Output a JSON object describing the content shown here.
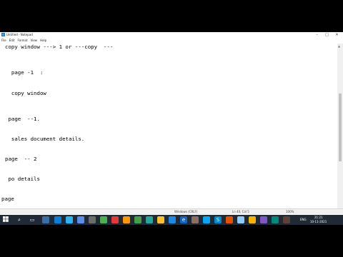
{
  "window": {
    "title": "Untitled - Notepad",
    "minimize_label": "–",
    "maximize_label": "□",
    "close_label": "✕"
  },
  "menu": [
    "File",
    "Edit",
    "Format",
    "View",
    "Help"
  ],
  "editor_lines": [
    "copy window ---> 1 or ---copy  ---",
    "  page -1  :",
    "  copy window",
    " page  --1.",
    "  sales document details.",
    "page  -- 2",
    " po details",
    "page"
  ],
  "status": {
    "line_ending": "Windows (CRLF)",
    "position": "Ln 40, Col 5",
    "zoom": "100%"
  },
  "tray": {
    "language": "ENG",
    "time": "21:21",
    "date": "10-11-2021"
  },
  "taskbar_icons": [
    "windows-start-icon",
    "search-icon",
    "task-view-icon",
    "file-explorer-icon",
    "edge-icon",
    "explorer-icon",
    "store-icon",
    "app-icon-1",
    "app-icon-2",
    "app-icon-3",
    "app-icon-4",
    "app-icon-5",
    "app-icon-6",
    "app-icon-7",
    "app-icon-8",
    "ie-icon",
    "app-icon-9",
    "app-icon-10",
    "skype-icon",
    "app-icon-11",
    "notepad-icon",
    "chrome-icon",
    "app-icon-12",
    "app-icon-13",
    "app-icon-14"
  ],
  "colors": {
    "taskbar": "#1f2a36",
    "accent": "#0078d7"
  }
}
